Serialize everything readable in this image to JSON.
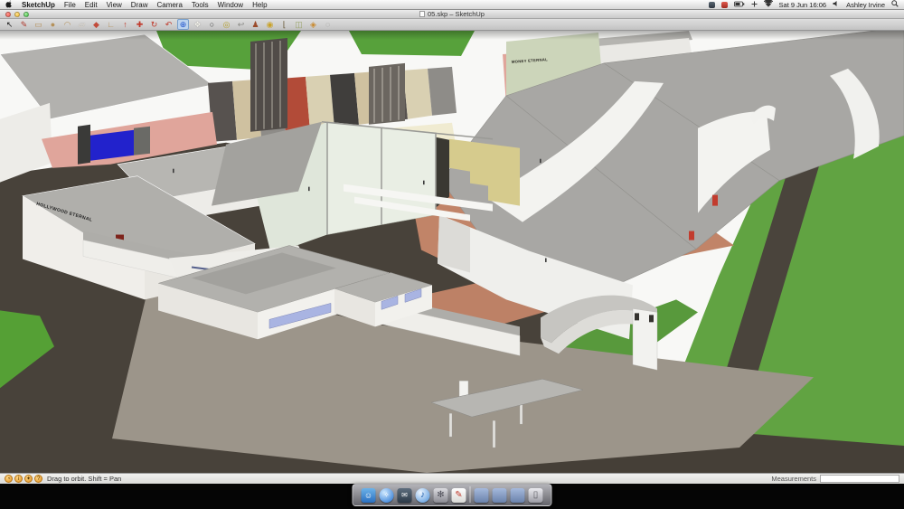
{
  "menu_bar": {
    "menus": [
      "SketchUp",
      "File",
      "Edit",
      "View",
      "Draw",
      "Camera",
      "Tools",
      "Window",
      "Help"
    ],
    "status_icons": [
      "app-badge-dark",
      "app-badge-red",
      "battery",
      "input-plus",
      "wifi"
    ],
    "clock": "Sat 9 Jun 16:06",
    "volume_icon": "volume",
    "user_name": "Ashley Irvine",
    "spotlight_icon": "spotlight-search"
  },
  "window": {
    "title": "05.skp – SketchUp",
    "traffic_lights": [
      "close",
      "minimize",
      "zoom"
    ]
  },
  "toolbar": {
    "active_tool": "orbit",
    "tools": [
      {
        "name": "select",
        "glyph": "↖"
      },
      {
        "name": "line",
        "glyph": "✎"
      },
      {
        "name": "rectangle",
        "glyph": "▭"
      },
      {
        "name": "circle",
        "glyph": "●"
      },
      {
        "name": "arc",
        "glyph": "◠"
      },
      {
        "name": "eraser",
        "glyph": "▱"
      },
      {
        "name": "paint-bucket",
        "glyph": "◆"
      },
      {
        "name": "tape-measure",
        "glyph": "∟"
      },
      {
        "name": "push-pull",
        "glyph": "↑"
      },
      {
        "name": "move",
        "glyph": "✚"
      },
      {
        "name": "rotate",
        "glyph": "↻"
      },
      {
        "name": "offset",
        "glyph": "↶"
      },
      {
        "name": "orbit",
        "glyph": "⊕"
      },
      {
        "name": "pan",
        "glyph": "❖"
      },
      {
        "name": "zoom",
        "glyph": "○"
      },
      {
        "name": "zoom-extents",
        "glyph": "◎"
      },
      {
        "name": "previous-view",
        "glyph": "↩"
      },
      {
        "name": "position-camera",
        "glyph": "♟"
      },
      {
        "name": "look-around",
        "glyph": "◉"
      },
      {
        "name": "walk",
        "glyph": "⌊"
      },
      {
        "name": "section-plane",
        "glyph": "◫"
      },
      {
        "name": "get-models",
        "glyph": "◈"
      },
      {
        "name": "photo-textures",
        "glyph": "◌"
      }
    ]
  },
  "viewport": {
    "sign_hollywood": "HOLLYWOOD ETERNAL",
    "sign_money": "MONEY ETERNAL"
  },
  "status_bar": {
    "icons": [
      {
        "name": "geolocation",
        "glyph": "◔"
      },
      {
        "name": "credits",
        "glyph": "i"
      },
      {
        "name": "model-info",
        "glyph": "✦"
      },
      {
        "name": "help",
        "glyph": "?"
      }
    ],
    "hint": "Drag to orbit.  Shift = Pan",
    "measurements_label": "Measurements",
    "measurements_value": ""
  },
  "dock": {
    "items": [
      "finder",
      "safari",
      "mail",
      "itunes",
      "system-preferences",
      "sketchup",
      "folder-documents",
      "folder-downloads",
      "folder-applications",
      "trash"
    ]
  },
  "colors": {
    "grass_green": "#5fa23e",
    "ground_dark": "#48423a",
    "ground_pad": "#9c958a",
    "terracotta": "#c18468",
    "roof_gray": "#a8a7a4",
    "wall_white": "#efefec",
    "wall_yellow": "#d6cb8d",
    "wall_pale_green": "#ccd5ba",
    "window_blue": "#a9b4e2",
    "accent_red": "#c23c2e",
    "street_pink": "#e0a59b",
    "screen_blue": "#2222cc"
  }
}
